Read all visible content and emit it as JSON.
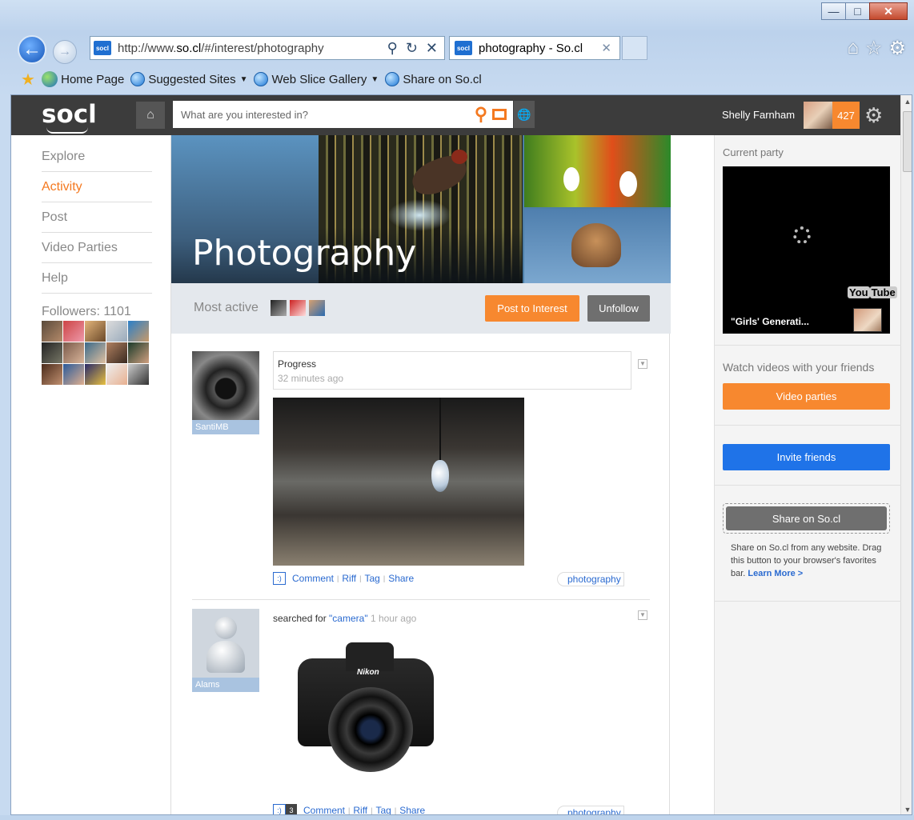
{
  "browser": {
    "url_prefix": "http://www.",
    "url_host": "so.cl",
    "url_path": "/#/interest/photography",
    "tab_title": "photography - So.cl",
    "favicon_text": "socl",
    "favorites": [
      "Home Page",
      "Suggested Sites",
      "Web Slice Gallery",
      "Share on So.cl"
    ]
  },
  "app": {
    "logo": "socl",
    "search_placeholder": "What are you interested in?",
    "user_name": "Shelly Farnham",
    "notification_count": "427"
  },
  "nav": {
    "items": [
      "Explore",
      "Activity",
      "Post",
      "Video Parties",
      "Help"
    ],
    "active": "Activity",
    "followers_label": "Followers: 1101"
  },
  "interest": {
    "title": "Photography",
    "most_active_label": "Most active",
    "post_button": "Post to Interest",
    "unfollow_button": "Unfollow"
  },
  "posts": [
    {
      "author": "SantiMB",
      "title": "Progress",
      "time": "32 minutes ago",
      "actions": [
        "Comment",
        "Riff",
        "Tag",
        "Share"
      ],
      "tag": "photography"
    },
    {
      "author": "Alams",
      "title_prefix": "searched for ",
      "query": "\"camera\"",
      "time": "1 hour ago",
      "comment_count": "3",
      "actions": [
        "Comment",
        "Riff",
        "Tag",
        "Share"
      ],
      "tag": "photography"
    }
  ],
  "right": {
    "current_party_label": "Current party",
    "video_title": "\"Girls' Generati...",
    "video_brand_1": "You",
    "video_brand_2": "Tube",
    "watch_label": "Watch videos with your friends",
    "video_parties_button": "Video parties",
    "invite_button": "Invite friends",
    "share_button": "Share on So.cl",
    "share_text": "Share on So.cl from any website. Drag this button to your browser's favorites bar.",
    "learn_more": "Learn More >"
  },
  "colors": {
    "accent_orange": "#f7882f",
    "active_nav": "#f47920",
    "link_blue": "#2a6ad0",
    "invite_blue": "#1f73e8",
    "topbar": "#3c3c3c"
  },
  "smile_glyph": ":)"
}
